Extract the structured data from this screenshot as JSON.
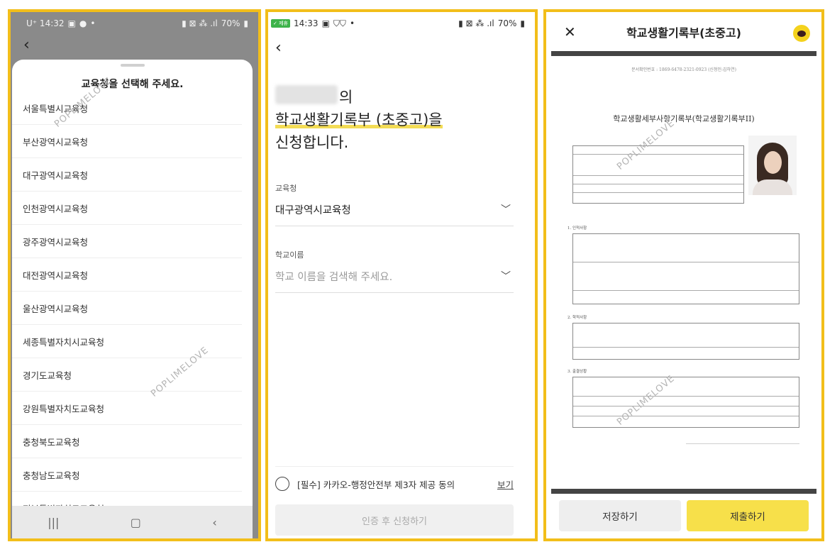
{
  "watermark": "POPLIMELOVE",
  "panel1": {
    "status": {
      "left": "U⁺ 14:32",
      "right": "70%"
    },
    "sheet_title": "교육청을 선택해 주세요.",
    "items": [
      "서울특별시교육청",
      "부산광역시교육청",
      "대구광역시교육청",
      "인천광역시교육청",
      "광주광역시교육청",
      "대전광역시교육청",
      "울산광역시교육청",
      "세종특별자치시교육청",
      "경기도교육청",
      "강원특별자치도교육청",
      "충청북도교육청",
      "충청남도교육청",
      "전북특별자치도교육청"
    ]
  },
  "panel2": {
    "status": {
      "time": "14:33",
      "right": "70%",
      "badge": "✓ 제휴"
    },
    "heading": {
      "suffix": "의",
      "line2": "학교생활기록부 (초중고)을",
      "line3": "신청합니다."
    },
    "office_field": {
      "label": "교육청",
      "value": "대구광역시교육청"
    },
    "school_field": {
      "label": "학교이름",
      "placeholder": "학교 이름을 검색해 주세요."
    },
    "consent": {
      "text": "[필수] 카카오-행정안전부 제3자 제공 동의",
      "link": "보기"
    },
    "submit_button": "인증 후 신청하기"
  },
  "panel3": {
    "title": "학교생활기록부(초중고)",
    "doc_number": "문서확인번호 : 1869-6478-2321-0923 (신청인:김하연)",
    "doc_title": "학교생활세부사항기록부(학교생활기록부II)",
    "sections": [
      "1. 인적사항",
      "2. 학적사항",
      "3. 출결상황"
    ],
    "save_button": "저장하기",
    "submit_button": "제출하기"
  }
}
